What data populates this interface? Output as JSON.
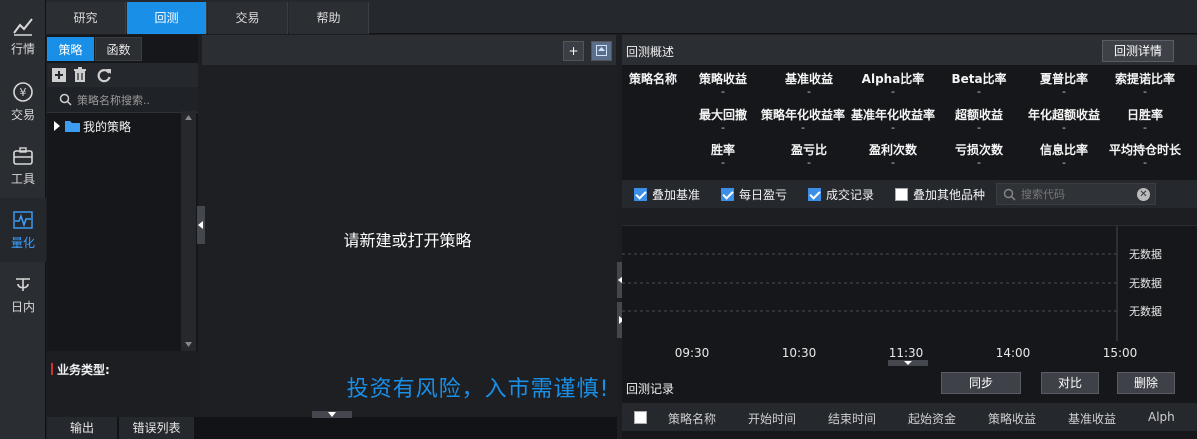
{
  "leftnav": [
    {
      "label": "行情",
      "icon": "chart-icon"
    },
    {
      "label": "交易",
      "icon": "yen-circle-icon"
    },
    {
      "label": "工具",
      "icon": "toolbox-icon"
    },
    {
      "label": "量化",
      "icon": "pulse-icon"
    },
    {
      "label": "日内",
      "icon": "intraday-icon"
    }
  ],
  "top_tabs": [
    "研究",
    "回测",
    "交易",
    "帮助"
  ],
  "strategy": {
    "tabs": [
      "策略",
      "函数"
    ],
    "search_placeholder": "策略名称搜索..",
    "tree_root": "我的策略",
    "business_type_label": "业务类型:"
  },
  "bottom_tabs": [
    "输出",
    "错误列表"
  ],
  "editor": {
    "add_label": "+",
    "empty_message": "请新建或打开策略",
    "risk_notice": "投资有风险，入市需谨慎!"
  },
  "overview": {
    "title": "回测概述",
    "detail_button": "回测详情",
    "rows": [
      [
        {
          "label": "策略名称",
          "value": ""
        },
        {
          "label": "策略收益",
          "value": "-"
        },
        {
          "label": "基准收益",
          "value": "-"
        },
        {
          "label": "Alpha比率",
          "value": "-"
        },
        {
          "label": "Beta比率",
          "value": "-"
        },
        {
          "label": "夏普比率",
          "value": "-"
        },
        {
          "label": "索提诺比率",
          "value": "-"
        }
      ],
      [
        {
          "label": "最大回撤",
          "value": "-"
        },
        {
          "label": "策略年化收益率",
          "value": "-"
        },
        {
          "label": "基准年化收益率",
          "value": "-"
        },
        {
          "label": "超额收益",
          "value": "-"
        },
        {
          "label": "年化超额收益",
          "value": "-"
        },
        {
          "label": "日胜率",
          "value": "-"
        }
      ],
      [
        {
          "label": "胜率",
          "value": "-"
        },
        {
          "label": "盈亏比",
          "value": "-"
        },
        {
          "label": "盈利次数",
          "value": "-"
        },
        {
          "label": "亏损次数",
          "value": "-"
        },
        {
          "label": "信息比率",
          "value": "-"
        },
        {
          "label": "平均持仓时长",
          "value": "-"
        }
      ]
    ]
  },
  "options": [
    {
      "label": "叠加基准",
      "checked": true
    },
    {
      "label": "每日盈亏",
      "checked": true
    },
    {
      "label": "成交记录",
      "checked": true
    },
    {
      "label": "叠加其他品种",
      "checked": false
    }
  ],
  "code_search_placeholder": "搜索代码",
  "chart_data": {
    "type": "line",
    "x_ticks": [
      "09:30",
      "10:30",
      "11:30",
      "14:00",
      "15:00"
    ],
    "panels": [
      "无数据",
      "无数据",
      "无数据"
    ],
    "series": []
  },
  "records": {
    "title": "回测记录",
    "buttons": [
      "同步",
      "对比",
      "删除"
    ],
    "columns": [
      "策略名称",
      "开始时间",
      "结束时间",
      "起始资金",
      "策略收益",
      "基准收益",
      "Alph"
    ]
  },
  "colors": {
    "accent": "#1a8fe8",
    "background": "#1c1e22",
    "panel": "#15171a"
  }
}
